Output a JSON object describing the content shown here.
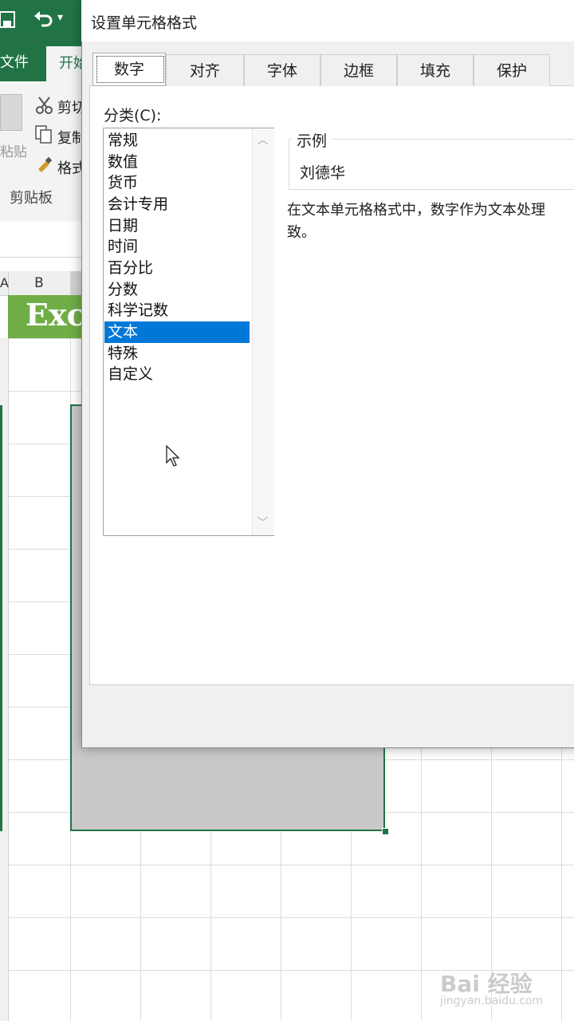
{
  "excel": {
    "quick_access": {
      "save_icon": "save-icon",
      "undo_icon": "undo-icon",
      "undo_dropdown": "▾"
    },
    "tabs": {
      "file": "文件",
      "home": "开始"
    },
    "clipboard": {
      "paste": "粘贴",
      "cut": "剪切",
      "copy": "复制",
      "format_painter": "格式",
      "group_label": "剪贴板"
    },
    "columns": {
      "a": "A",
      "b": "B"
    },
    "banner_text": "Exc",
    "accent_color": "#217346",
    "banner_color": "#70ad47"
  },
  "dialog": {
    "title": "设置单元格格式",
    "tabs": [
      {
        "label": "数字",
        "active": true
      },
      {
        "label": "对齐",
        "active": false
      },
      {
        "label": "字体",
        "active": false
      },
      {
        "label": "边框",
        "active": false
      },
      {
        "label": "填充",
        "active": false
      },
      {
        "label": "保护",
        "active": false
      }
    ],
    "category_label": "分类(C):",
    "categories": [
      "常规",
      "数值",
      "货币",
      "会计专用",
      "日期",
      "时间",
      "百分比",
      "分数",
      "科学记数",
      "文本",
      "特殊",
      "自定义"
    ],
    "selected_category": "文本",
    "sample_legend": "示例",
    "sample_value": "刘德华",
    "description_line1": "在文本单元格格式中，数字作为文本处理",
    "description_line2": "致。",
    "selection_color": "#0078d7"
  },
  "watermark": {
    "main": "Bai 经验",
    "sub": "jingyan.baidu.com"
  }
}
